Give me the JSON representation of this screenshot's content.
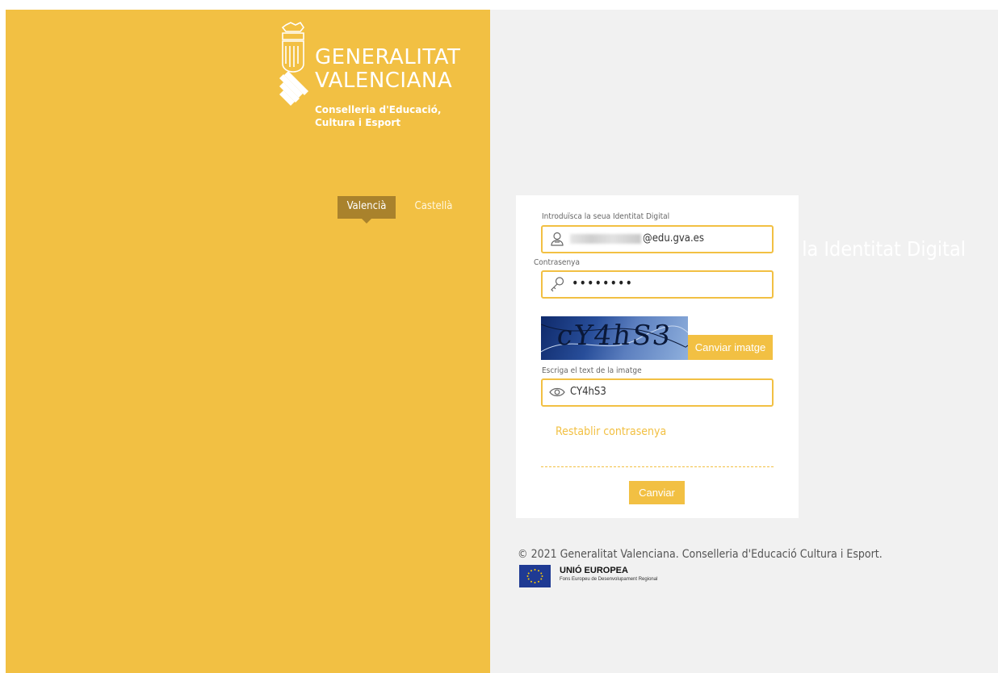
{
  "brand": {
    "line1": "GENERALITAT",
    "line2": "VALENCIANA",
    "dept1": "Conselleria d'Educació,",
    "dept2": "Cultura i Esport"
  },
  "language": {
    "active": "Valencià",
    "inactive": "Castellà"
  },
  "page_title": "Canvi de contrasenya de la Identitat Digital",
  "form": {
    "identity_label": "Introduïsca la seua Identitat Digital",
    "identity_suffix": "@edu.gva.es",
    "password_label": "Contrasenya",
    "password_value": "••••••••",
    "captcha_text": "cY4hS3",
    "change_image_label": "Canviar imatge",
    "captcha_input_label": "Escriga el text de la imatge",
    "captcha_input_value": "CY4hS3",
    "restore_link": "Restablir contrasenya",
    "submit_label": "Canviar"
  },
  "footer": {
    "copyright": "© 2021 Generalitat Valenciana. Conselleria d'Educació Cultura i Esport.",
    "eu_title": "UNIÓ EUROPEA",
    "eu_sub": "Fons Europeu de Desenvolupament Regional"
  },
  "colors": {
    "accent": "#f2c043",
    "accent_dark": "#a9822c",
    "right_bg": "#f1f1f1"
  },
  "icons": {
    "identity": "user-icon",
    "password": "key-icon",
    "captcha": "eye-icon"
  }
}
